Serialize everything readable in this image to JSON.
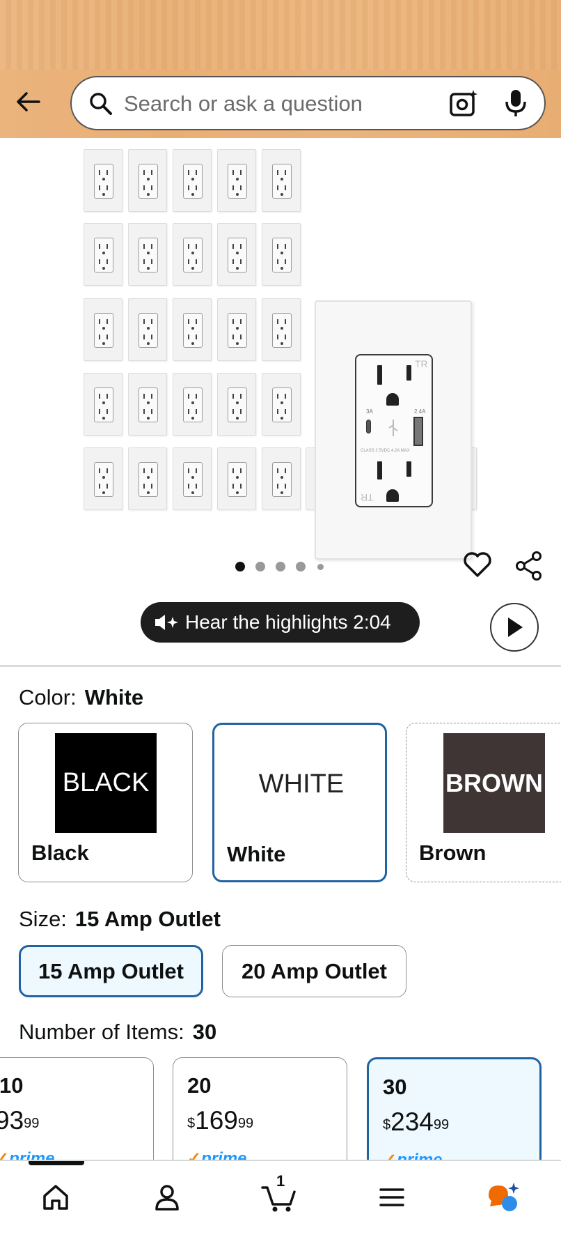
{
  "search": {
    "placeholder": "Search or ask a question"
  },
  "gallery": {
    "outlet_labels": {
      "usb_c": "3A",
      "usb_a": "2.4A",
      "class": "CLASS 2 5VDC 4.2A MAX",
      "tr_top": "TR",
      "tr_bottom": "TR"
    },
    "dots_count": 5,
    "active_dot": 0
  },
  "highlights": {
    "label": "Hear the highlights 2:04"
  },
  "color": {
    "label": "Color:",
    "selected": "White",
    "options": [
      {
        "swatch_text": "BLACK",
        "name": "Black",
        "swatch_bg": "#000000",
        "swatch_fg": "#ffffff"
      },
      {
        "swatch_text": "WHITE",
        "name": "White",
        "swatch_bg": "#ffffff",
        "swatch_fg": "#222222"
      },
      {
        "swatch_text": "BROWN",
        "name": "Brown",
        "swatch_bg": "#3f3535",
        "swatch_fg": "#ffffff"
      }
    ]
  },
  "size": {
    "label": "Size:",
    "selected": "15 Amp Outlet",
    "options": [
      "15 Amp Outlet",
      "20 Amp Outlet"
    ]
  },
  "count": {
    "label": "Number of Items:",
    "selected": "30",
    "options": [
      {
        "n": "10",
        "price_cur": "",
        "price_whole": "93",
        "price_frac": "99",
        "prime": "prime"
      },
      {
        "n": "20",
        "price_cur": "$",
        "price_whole": "169",
        "price_frac": "99",
        "prime": "prime"
      },
      {
        "n": "30",
        "price_cur": "$",
        "price_whole": "234",
        "price_frac": "99",
        "prime": "prime"
      }
    ]
  },
  "nav": {
    "cart_count": "1"
  },
  "colors": {
    "accent_blue": "#2162a1",
    "selected_bg": "#edf8ff",
    "prime_blue": "#1a98ff",
    "header": "#eab47d"
  }
}
